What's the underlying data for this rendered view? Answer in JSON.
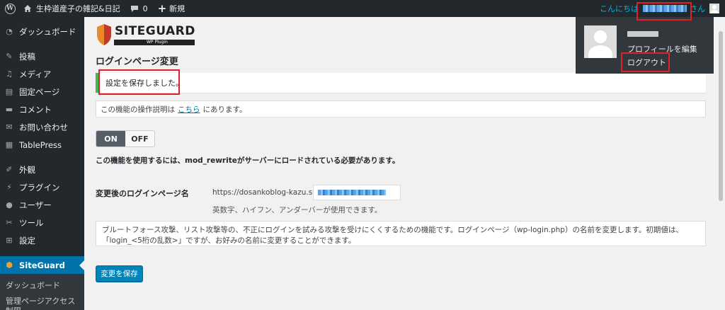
{
  "adminbar": {
    "site_name": "生枠道産子の雑記&日記",
    "comment_count": "0",
    "new_label": "新規",
    "howdy_prefix": "こんにちは",
    "howdy_suffix": "さん"
  },
  "account_menu": {
    "edit_profile": "プロフィールを編集",
    "logout": "ログアウト"
  },
  "sidebar": {
    "items": [
      {
        "label": "ダッシュボード",
        "icon": "dashboard-icon"
      },
      {
        "label": "投稿",
        "icon": "pin-icon"
      },
      {
        "label": "メディア",
        "icon": "media-icon"
      },
      {
        "label": "固定ページ",
        "icon": "page-icon"
      },
      {
        "label": "コメント",
        "icon": "comment-icon"
      },
      {
        "label": "お問い合わせ",
        "icon": "mail-icon"
      },
      {
        "label": "TablePress",
        "icon": "table-icon"
      },
      {
        "label": "外観",
        "icon": "brush-icon"
      },
      {
        "label": "プラグイン",
        "icon": "plugin-icon"
      },
      {
        "label": "ユーザー",
        "icon": "user-icon"
      },
      {
        "label": "ツール",
        "icon": "wrench-icon"
      },
      {
        "label": "設定",
        "icon": "settings-icon"
      },
      {
        "label": "SiteGuard",
        "icon": "siteguard-icon"
      }
    ],
    "submenu": [
      "ダッシュボード",
      "管理ページアクセス制限"
    ]
  },
  "main": {
    "logo_text": "SITEGUARD",
    "logo_sub": "WP Plugin",
    "page_title": "ログインページ変更",
    "notice": "設定を保存しました。",
    "info_prefix": "この機能の操作説明は",
    "info_link": "こちら",
    "info_suffix": "にあります。",
    "toggle_on": "ON",
    "toggle_off": "OFF",
    "requirement": "この機能を使用するには、mod_rewriteがサーバーにロードされている必要があります。",
    "field_label": "変更後のログインページ名",
    "url_prefix": "https://dosankoblog-kazu.site/",
    "hint": "英数字、ハイフン、アンダーバーが使用できます。",
    "description": "ブルートフォース攻撃、リスト攻撃等の、不正にログインを試みる攻撃を受けにくくするための機能です。ログインページ（wp-login.php）の名前を変更します。初期値は、「login_<5桁の乱数>」ですが、お好みの名前に変更することができます。",
    "save_button": "変更を保存"
  },
  "colors": {
    "adminbar_bg": "#23282d",
    "accent": "#0073aa",
    "button": "#0085ba",
    "notice_success": "#46b450",
    "annotation": "#e0202c"
  }
}
